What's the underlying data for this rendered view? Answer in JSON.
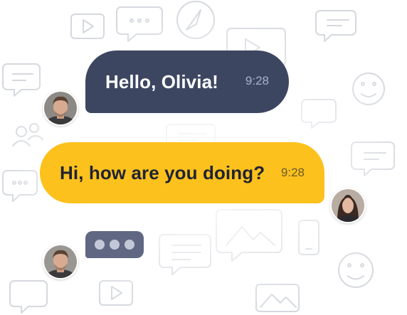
{
  "messages": [
    {
      "text": "Hello, Olivia!",
      "time": "9:28",
      "color": "#3d4661"
    },
    {
      "text": "Hi, how are you doing?",
      "time": "9:28",
      "color": "#fdc11d"
    }
  ],
  "typing_indicator": {
    "color": "#5f6783"
  },
  "icons": [
    "chat-bubble-icon",
    "play-icon",
    "smiley-icon",
    "compass-icon",
    "user-group-icon",
    "image-icon",
    "phone-icon"
  ]
}
